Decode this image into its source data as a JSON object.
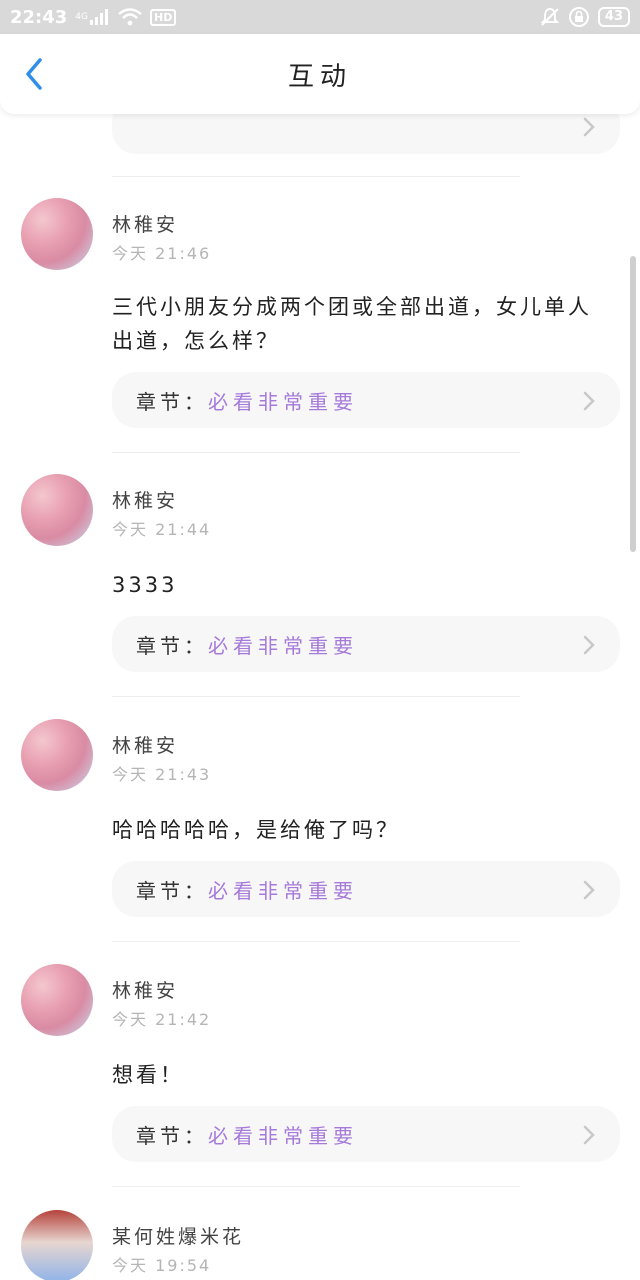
{
  "status_bar": {
    "time": "22:43",
    "network": "4G",
    "hd": "HD",
    "battery": "43"
  },
  "header": {
    "title": "互动"
  },
  "chapter_label": "章节：",
  "comments": [
    {
      "user": "林稚安",
      "time": "今天 21:46",
      "text": "三代小朋友分成两个团或全部出道，女儿单人出道，怎么样？",
      "chapter": "必看非常重要"
    },
    {
      "user": "林稚安",
      "time": "今天 21:44",
      "text": "3333",
      "chapter": "必看非常重要"
    },
    {
      "user": "林稚安",
      "time": "今天 21:43",
      "text": "哈哈哈哈哈，是给俺了吗？",
      "chapter": "必看非常重要"
    },
    {
      "user": "林稚安",
      "time": "今天 21:42",
      "text": "想看！",
      "chapter": "必看非常重要"
    },
    {
      "user": "某何姓爆米花",
      "time": "今天 19:54"
    }
  ],
  "colors": {
    "accent_purple": "#a57ad9",
    "back_blue": "#2f8fe8"
  }
}
